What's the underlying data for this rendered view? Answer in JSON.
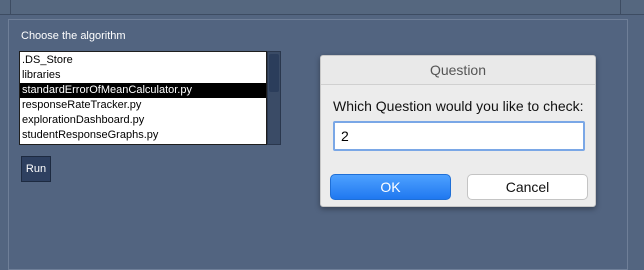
{
  "panel": {
    "title": "Choose the algorithm",
    "files": [
      ".DS_Store",
      "libraries",
      "standardErrorOfMeanCalculator.py",
      "responseRateTracker.py",
      "explorationDashboard.py",
      "studentResponseGraphs.py"
    ],
    "selected_file": "standardErrorOfMeanCalculator.py",
    "run_label": "Run"
  },
  "dialog": {
    "title": "Question",
    "prompt": "Which Question would you like to check:",
    "input_value": "2",
    "ok_label": "OK",
    "cancel_label": "Cancel"
  },
  "colors": {
    "background": "#536580",
    "selection": "#000000",
    "ok_button": "#2a86f6"
  }
}
